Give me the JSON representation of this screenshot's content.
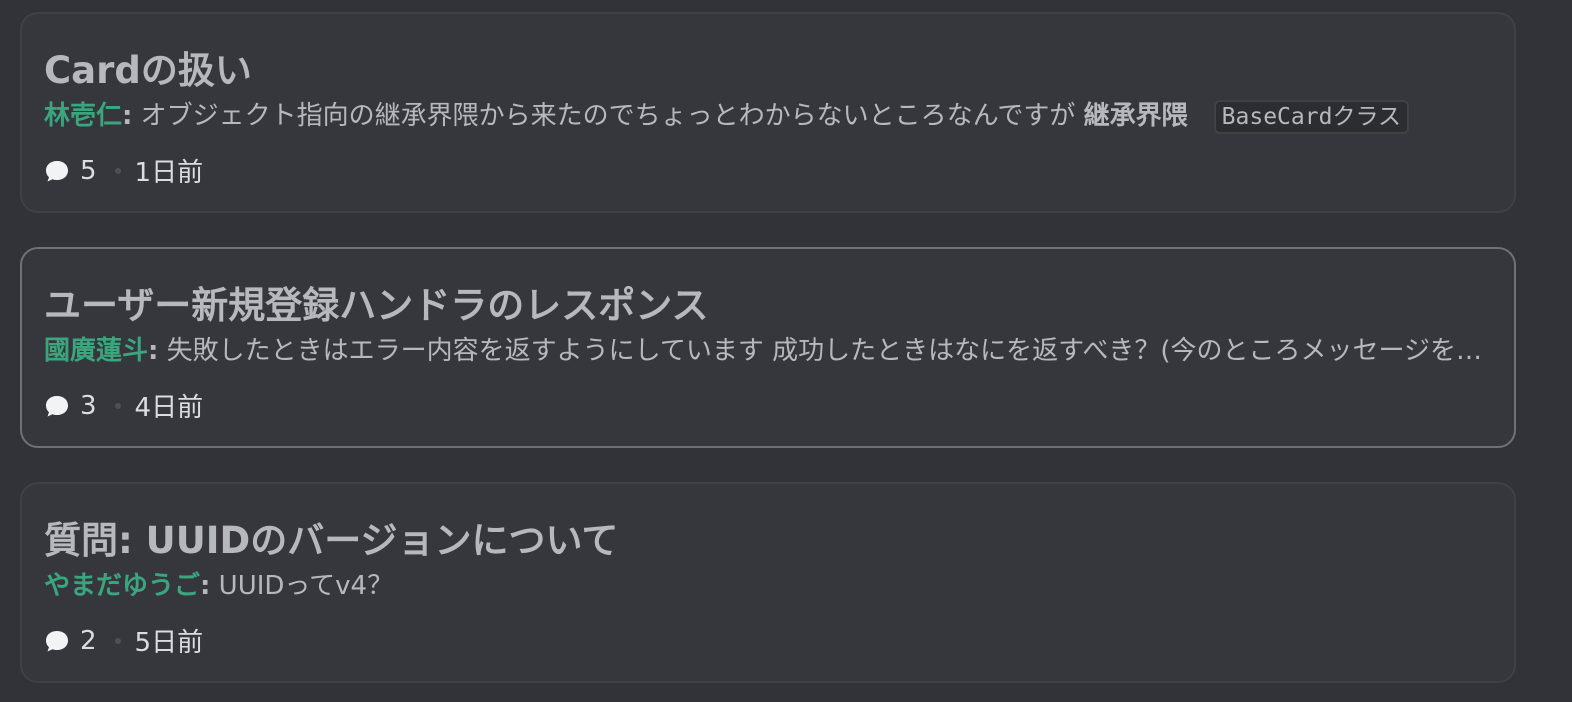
{
  "threads": [
    {
      "title": "Cardの扱い",
      "author": "林壱仁",
      "separator": ":",
      "preview": " オブジェクト指向の継承界隈から来たのでちょっとわからないところなんですが ",
      "preview_bold": "継承界隈",
      "preview_code": "BaseCardクラス",
      "reply_count": "5",
      "time": "1日前"
    },
    {
      "title": "ユーザー新規登録ハンドラのレスポンス",
      "author": "國廣蓮斗",
      "separator": ":",
      "preview": " 失敗したときはエラー内容を返すようにしています 成功したときはなにを返すべき？(今のところメッセージを返しています)",
      "reply_count": "3",
      "time": "4日前"
    },
    {
      "title": "質問: UUIDのバージョンについて",
      "author": "やまだゆうご",
      "separator": ":",
      "preview": " UUIDってv4？",
      "reply_count": "2",
      "time": "5日前"
    }
  ],
  "icons": {
    "reply": "speech-bubble-icon"
  },
  "colors": {
    "background": "#313338",
    "card": "#36373d",
    "author": "#3ba57d",
    "text": "#b5b8bd"
  }
}
